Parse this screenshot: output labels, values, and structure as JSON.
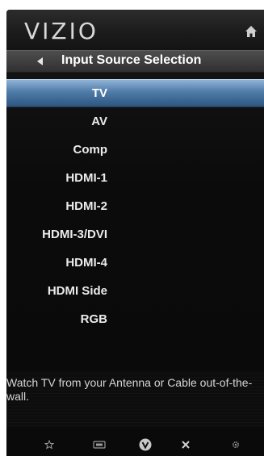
{
  "header": {
    "brand": "VIZIO",
    "home_icon": "home-icon"
  },
  "menu": {
    "title": "Input Source Selection",
    "back_icon": "left-arrow-icon"
  },
  "sources": [
    {
      "label": "TV",
      "selected": true
    },
    {
      "label": "AV",
      "selected": false
    },
    {
      "label": "Comp",
      "selected": false
    },
    {
      "label": "HDMI-1",
      "selected": false
    },
    {
      "label": "HDMI-2",
      "selected": false
    },
    {
      "label": "HDMI-3/DVI",
      "selected": false
    },
    {
      "label": "HDMI-4",
      "selected": false
    },
    {
      "label": "HDMI Side",
      "selected": false
    },
    {
      "label": "RGB",
      "selected": false
    }
  ],
  "description": "Watch TV from your Antenna or Cable out-of-the-wall.",
  "footer_icons": [
    "star-icon",
    "widget-icon",
    "vizio-v-icon",
    "close-icon",
    "gear-icon"
  ],
  "colors": {
    "selection": "#4f7ba8",
    "background": "#0a0a0a"
  }
}
